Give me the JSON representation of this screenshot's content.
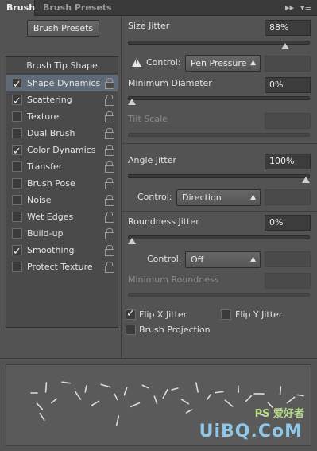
{
  "tabs": [
    {
      "label": "Brush"
    },
    {
      "label": "Brush Presets"
    }
  ],
  "toolbar": {
    "presets_button": "Brush Presets"
  },
  "tip_shape_header": "Brush Tip Shape",
  "options": [
    {
      "label": "Shape Dynamics",
      "checked": true,
      "selected": true
    },
    {
      "label": "Scattering",
      "checked": true
    },
    {
      "label": "Texture",
      "checked": false
    },
    {
      "label": "Dual Brush",
      "checked": false
    },
    {
      "label": "Color Dynamics",
      "checked": true
    },
    {
      "label": "Transfer",
      "checked": false
    },
    {
      "label": "Brush Pose",
      "checked": false
    },
    {
      "label": "Noise",
      "checked": false
    },
    {
      "label": "Wet Edges",
      "checked": false
    },
    {
      "label": "Build-up",
      "checked": false
    },
    {
      "label": "Smoothing",
      "checked": true
    },
    {
      "label": "Protect Texture",
      "checked": false
    }
  ],
  "size_jitter": {
    "label": "Size Jitter",
    "value": "88%",
    "level": 0.88
  },
  "size_control": {
    "label": "Control:",
    "value": "Pen Pressure"
  },
  "min_diameter": {
    "label": "Minimum Diameter",
    "value": "0%",
    "level": 0.0
  },
  "tilt_scale": {
    "label": "Tilt Scale"
  },
  "angle_jitter": {
    "label": "Angle Jitter",
    "value": "100%",
    "level": 1.0
  },
  "angle_control": {
    "label": "Control:",
    "value": "Direction"
  },
  "roundness_jitter": {
    "label": "Roundness Jitter",
    "value": "0%",
    "level": 0.0
  },
  "roundness_control": {
    "label": "Control:",
    "value": "Off"
  },
  "min_roundness": {
    "label": "Minimum Roundness"
  },
  "flip_x": {
    "label": "Flip X Jitter",
    "checked": true
  },
  "flip_y": {
    "label": "Flip Y Jitter",
    "checked": false
  },
  "brush_projection": {
    "label": "Brush Projection",
    "checked": false
  },
  "watermark": {
    "text": "UiBQ.CoM",
    "subtext": "PS 爱好者"
  },
  "icons": {
    "collapse": "double-chevron-right-icon",
    "menu": "panel-menu-icon",
    "warning": "warning-icon",
    "lock": "lock-icon"
  }
}
